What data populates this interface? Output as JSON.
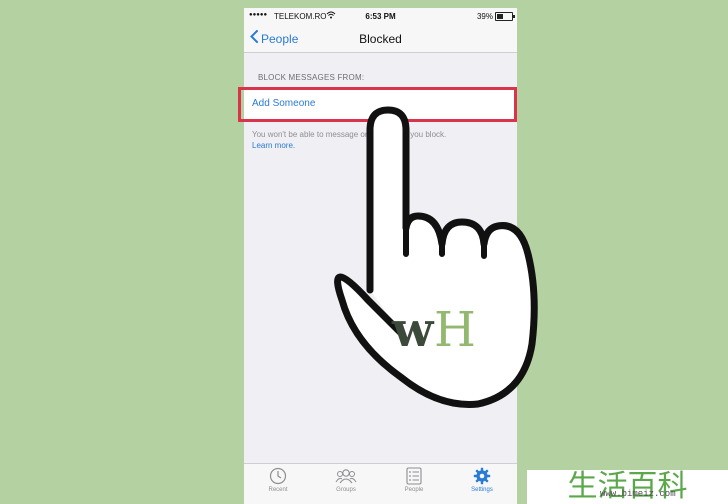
{
  "status_bar": {
    "signal": "●●●●●",
    "carrier": "TELEKOM.RO",
    "time": "6:53 PM",
    "battery": "39%"
  },
  "nav": {
    "back_label": "People",
    "title": "Blocked"
  },
  "section": {
    "header": "BLOCK MESSAGES FROM:",
    "cell_label": "Add Someone",
    "footer_text": "You won't be able to message or call people you block.",
    "footer_link": "Learn more."
  },
  "tabs": [
    {
      "label": "Recent",
      "icon": "clock-icon"
    },
    {
      "label": "Groups",
      "icon": "groups-icon"
    },
    {
      "label": "People",
      "icon": "people-list-icon"
    },
    {
      "label": "Settings",
      "icon": "gear-icon",
      "active": true
    }
  ],
  "overlay": {
    "logo_text": "wH",
    "watermark": "生活百科",
    "watermark_url": "www.bimeiz.com"
  },
  "colors": {
    "background": "#b4d1a1",
    "accent": "#2a7bd3",
    "highlight": "#d9344b"
  }
}
